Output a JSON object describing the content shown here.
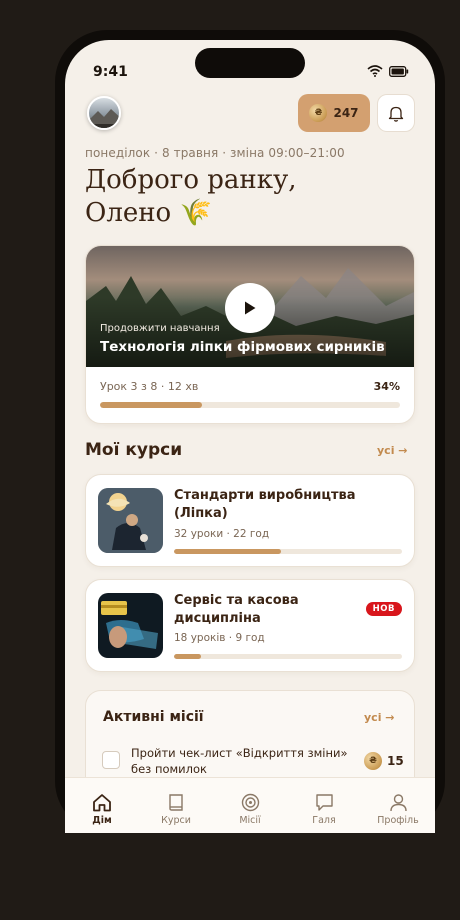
{
  "status": {
    "time": "9:41"
  },
  "header": {
    "coins": "247",
    "coin_glyph": "₴"
  },
  "date_line": "понеділок · 8 травня · зміна 09:00–21:00",
  "greeting": {
    "line1": "Доброго ранку,",
    "line2": "Олено 🌾"
  },
  "hero": {
    "kicker": "Продовжити навчання",
    "title": "Технологія ліпки фірмових сирників",
    "meta": "Урок 3 з 8 · 12 хв",
    "progress_label": "34%",
    "progress": 0.34
  },
  "courses_section": {
    "title": "Мої курси",
    "link": "усі →"
  },
  "courses": [
    {
      "title": "Стандарти виробництва (Ліпка)",
      "meta": "32 уроки · 22 год",
      "progress": 0.47,
      "badge": ""
    },
    {
      "title": "Сервіс та касова дисципліна",
      "meta": "18 уроків · 9 год",
      "progress": 0.12,
      "badge": "НОВ"
    }
  ],
  "missions": {
    "title": "Активні місії",
    "link": "усі →",
    "items": [
      {
        "text": "Пройти чек-лист «Відкриття зміни» без помилок",
        "reward": "15"
      }
    ]
  },
  "tabs": [
    {
      "label": "Дім",
      "icon": "home-icon",
      "active": true
    },
    {
      "label": "Курси",
      "icon": "book-icon",
      "active": false
    },
    {
      "label": "Місії",
      "icon": "target-icon",
      "active": false
    },
    {
      "label": "Галя",
      "icon": "chat-icon",
      "active": false
    },
    {
      "label": "Профіль",
      "icon": "user-icon",
      "active": false
    }
  ],
  "colors": {
    "background": "#f5f0e9",
    "accent": "#c99760",
    "text": "#3b2414",
    "badge": "#d8161c"
  }
}
